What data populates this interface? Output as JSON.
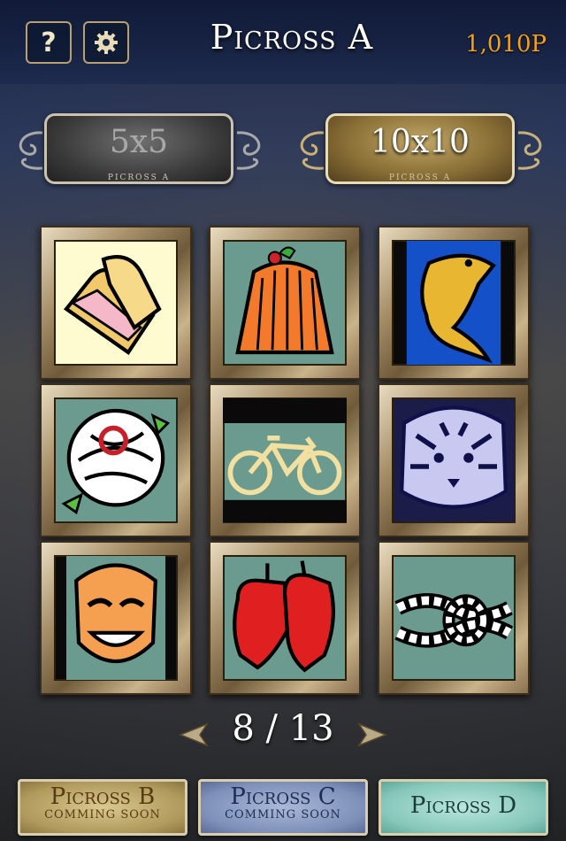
{
  "header": {
    "help_label": "?",
    "title": "Picross A",
    "points": "1,010P"
  },
  "size_tabs": [
    {
      "label": "5x5",
      "sub": "PICROSS A",
      "selected": false
    },
    {
      "label": "10x10",
      "sub": "PICROSS A",
      "selected": true
    }
  ],
  "puzzles": [
    {
      "icon": "toast-sandwich-icon"
    },
    {
      "icon": "pudding-icon"
    },
    {
      "icon": "fish-icon"
    },
    {
      "icon": "rose-icon"
    },
    {
      "icon": "bicycle-icon"
    },
    {
      "icon": "tiger-icon"
    },
    {
      "icon": "mask-icon"
    },
    {
      "icon": "boxing-gloves-icon"
    },
    {
      "icon": "rope-knot-icon"
    }
  ],
  "pager": {
    "current": "8",
    "separator": "/",
    "total": "13"
  },
  "packs": [
    {
      "name": "Picross B",
      "status": "COMMING SOON"
    },
    {
      "name": "Picross C",
      "status": "COMMING SOON"
    },
    {
      "name": "Picross D",
      "status": ""
    }
  ],
  "colors": {
    "accent": "#f2a21a",
    "frame_gold": "#a8916a"
  }
}
